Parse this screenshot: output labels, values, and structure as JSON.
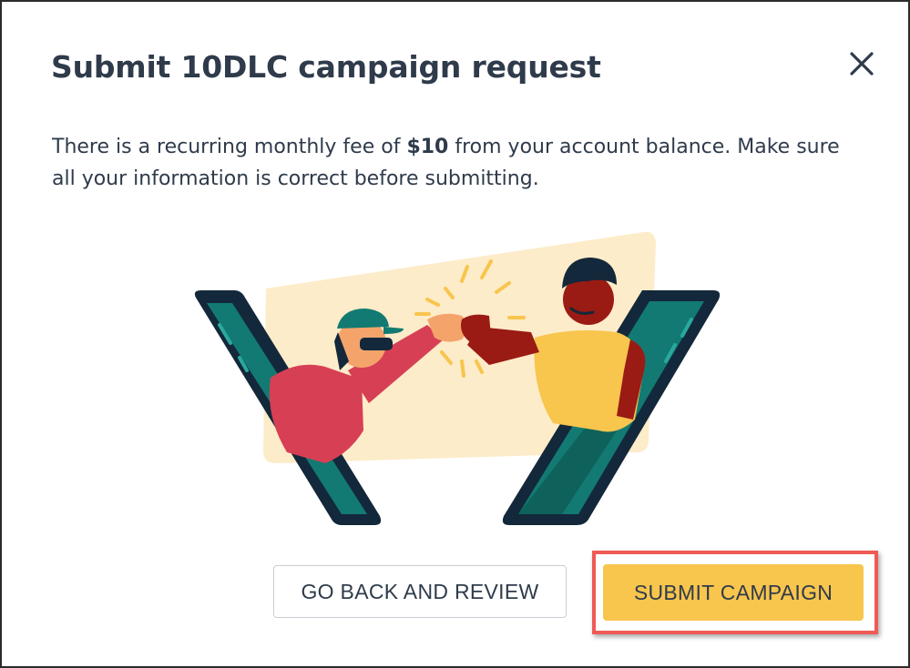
{
  "dialog": {
    "title": "Submit 10DLC campaign request",
    "close_icon": "close-icon",
    "message_before": "There is a recurring monthly fee of ",
    "message_amount": "$10",
    "message_after": " from your account balance. Make sure all your information is correct before submitting.",
    "illustration": "two-people-fist-bump-through-phones"
  },
  "actions": {
    "back_label": "GO BACK AND REVIEW",
    "submit_label": "SUBMIT CAMPAIGN"
  },
  "colors": {
    "text": "#2f3b4b",
    "primary_button": "#f8c54d",
    "highlight": "#ef5a55",
    "secondary_border": "#c9cdd3"
  }
}
